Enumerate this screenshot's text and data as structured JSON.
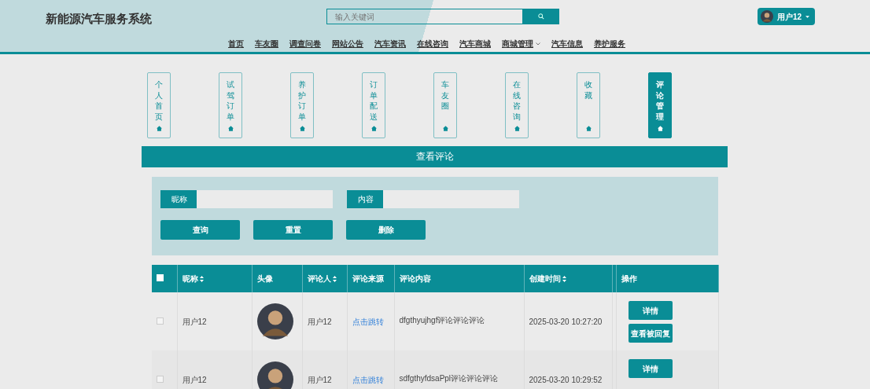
{
  "header": {
    "title": "新能源汽车服务系统",
    "search": {
      "placeholder": "输入关键词"
    },
    "user": "用户12",
    "nav": [
      {
        "label": "首页",
        "dropdown": false
      },
      {
        "label": "车友圈",
        "dropdown": false
      },
      {
        "label": "调查问卷",
        "dropdown": false
      },
      {
        "label": "网站公告",
        "dropdown": false
      },
      {
        "label": "汽车资讯",
        "dropdown": false
      },
      {
        "label": "在线咨询",
        "dropdown": false
      },
      {
        "label": "汽车商城",
        "dropdown": false
      },
      {
        "label": "商城管理",
        "dropdown": true
      },
      {
        "label": "汽车信息",
        "dropdown": false
      },
      {
        "label": "养护服务",
        "dropdown": false
      }
    ]
  },
  "side_menu": [
    {
      "label": "个人首页",
      "selected": false
    },
    {
      "label": "试驾订单",
      "selected": false
    },
    {
      "label": "养护订单",
      "selected": false
    },
    {
      "label": "订单配送",
      "selected": false
    },
    {
      "label": "车友圈",
      "selected": false
    },
    {
      "label": "在线咨询",
      "selected": false
    },
    {
      "label": "收藏",
      "selected": false
    },
    {
      "label": "评论管理",
      "selected": true
    }
  ],
  "panel": {
    "title": "查看评论",
    "filters": [
      {
        "label": "昵称"
      },
      {
        "label": "内容"
      }
    ],
    "buttons": [
      "查询",
      "重置",
      "删除"
    ]
  },
  "table": {
    "select_all": false,
    "columns": [
      {
        "label": "昵称",
        "sortable": true
      },
      {
        "label": "头像",
        "sortable": false
      },
      {
        "label": "评论人",
        "sortable": true
      },
      {
        "label": "评论来源",
        "sortable": false
      },
      {
        "label": "评论内容",
        "sortable": false
      },
      {
        "label": "创建时间",
        "sortable": true
      },
      {
        "label": "操作",
        "sortable": false
      }
    ],
    "rows": [
      {
        "checked": false,
        "nickname": "用户12",
        "commenter": "用户12",
        "source": "点击跳转",
        "content": "dfgthyujhgf评论评论评论",
        "created": "2025-03-20 10:27:20",
        "actions": [
          "详情",
          "查看被回复"
        ]
      },
      {
        "checked": false,
        "nickname": "用户12",
        "commenter": "用户12",
        "source": "点击跳转",
        "content": "sdfgthyfdsaPpl评论评论评论",
        "created": "2025-03-20 10:29:52",
        "actions": [
          "详情"
        ]
      }
    ]
  }
}
